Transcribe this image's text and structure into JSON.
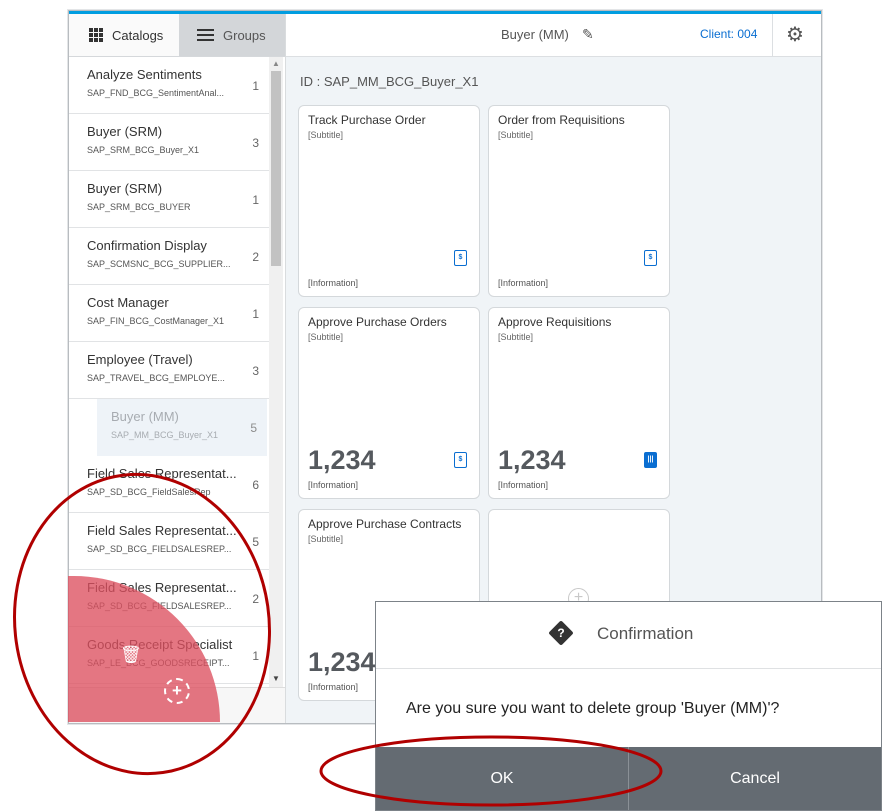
{
  "left_panel": {
    "tabs": {
      "catalogs": "Catalogs",
      "groups": "Groups"
    },
    "groups": [
      {
        "title": "Analyze Sentiments",
        "id": "SAP_FND_BCG_SentimentAnal...",
        "count": "1"
      },
      {
        "title": "Buyer (SRM)",
        "id": "SAP_SRM_BCG_Buyer_X1",
        "count": "3"
      },
      {
        "title": "Buyer (SRM)",
        "id": "SAP_SRM_BCG_BUYER",
        "count": "1"
      },
      {
        "title": "Confirmation Display",
        "id": "SAP_SCMSNC_BCG_SUPPLIER...",
        "count": "2"
      },
      {
        "title": "Cost Manager",
        "id": "SAP_FIN_BCG_CostManager_X1",
        "count": "1"
      },
      {
        "title": "Employee (Travel)",
        "id": "SAP_TRAVEL_BCG_EMPLOYE...",
        "count": "3"
      },
      {
        "title": "Buyer (MM)",
        "id": "SAP_MM_BCG_Buyer_X1",
        "count": "5"
      },
      {
        "title": "Field Sales Representat...",
        "id": "SAP_SD_BCG_FieldSalesRep",
        "count": "6"
      },
      {
        "title": "Field Sales Representat...",
        "id": "SAP_SD_BCG_FIELDSALESREP...",
        "count": "5"
      },
      {
        "title": "Field Sales Representat...",
        "id": "SAP_SD_BCG_FIELDSALESREP...",
        "count": "2"
      },
      {
        "title": "Goods Receipt Specialist",
        "id": "SAP_LE_BCG_GOODSRECEIPT...",
        "count": "1"
      }
    ]
  },
  "header": {
    "title": "Buyer (MM)",
    "client": "Client: 004"
  },
  "group_id": "ID : SAP_MM_BCG_Buyer_X1",
  "tiles": [
    {
      "title": "Track Purchase Order",
      "subtitle": "[Subtitle]",
      "info": "[Information]",
      "number": "",
      "icon": "document-dollar-icon"
    },
    {
      "title": "Order from Requisitions",
      "subtitle": "[Subtitle]",
      "info": "[Information]",
      "number": "",
      "icon": "documents-dollar-icon"
    },
    {
      "title": "Approve Purchase Orders",
      "subtitle": "[Subtitle]",
      "info": "[Information]",
      "number": "1,234",
      "icon": "document-dollar-icon"
    },
    {
      "title": "Approve Requisitions",
      "subtitle": "[Subtitle]",
      "info": "[Information]",
      "number": "1,234",
      "icon": "barcode-icon"
    },
    {
      "title": "Approve Purchase Contracts",
      "subtitle": "[Subtitle]",
      "info": "[Information]",
      "number": "1,234",
      "icon": "document-dollar-icon"
    }
  ],
  "dialog": {
    "title": "Confirmation",
    "message": "Are you sure you want to delete group 'Buyer (MM)'?",
    "ok": "OK",
    "cancel": "Cancel"
  },
  "colors": {
    "accent": "#0a6ed1",
    "topline": "#009de0",
    "delete_zone": "#dc505f",
    "dialog_buttons": "#646b72",
    "annotation": "#b00000"
  }
}
